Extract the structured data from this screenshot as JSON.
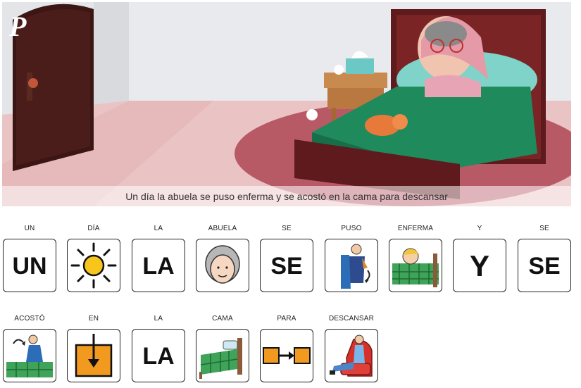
{
  "caption": "Un día la abuela se puso enferma y se acostó en la cama para descansar",
  "publisher_logo": "P",
  "row1": [
    {
      "word": "UN",
      "symbol": "UN",
      "icon": "text"
    },
    {
      "word": "DÍA",
      "symbol": "",
      "icon": "sun-icon"
    },
    {
      "word": "LA",
      "symbol": "LA",
      "icon": "text"
    },
    {
      "word": "ABUELA",
      "symbol": "",
      "icon": "grandmother-face-icon"
    },
    {
      "word": "SE",
      "symbol": "SE",
      "icon": "text"
    },
    {
      "word": "PUSO",
      "symbol": "",
      "icon": "person-dressing-icon"
    },
    {
      "word": "ENFERMA",
      "symbol": "",
      "icon": "sick-in-bed-icon"
    },
    {
      "word": "Y",
      "symbol": "Y",
      "icon": "text"
    },
    {
      "word": "SE",
      "symbol": "SE",
      "icon": "text"
    }
  ],
  "row2": [
    {
      "word": "ACOSTÓ",
      "symbol": "",
      "icon": "lying-down-icon"
    },
    {
      "word": "EN",
      "symbol": "",
      "icon": "in-arrow-box-icon"
    },
    {
      "word": "LA",
      "symbol": "LA",
      "icon": "text"
    },
    {
      "word": "CAMA",
      "symbol": "",
      "icon": "bed-icon"
    },
    {
      "word": "PARA",
      "symbol": "",
      "icon": "for-arrow-icon"
    },
    {
      "word": "DESCANSAR",
      "symbol": "",
      "icon": "resting-armchair-icon"
    }
  ],
  "colors": {
    "wall": "#e4e5e9",
    "floor": "#e8b6b8",
    "rug": "#b85060",
    "bedspread": "#1f8a5c",
    "bed_wood": "#5e1a1c",
    "door": "#3c1614",
    "pillow": "#7fd3c8",
    "sun": "#f7c51c",
    "arrow_orange": "#f29a1f"
  }
}
